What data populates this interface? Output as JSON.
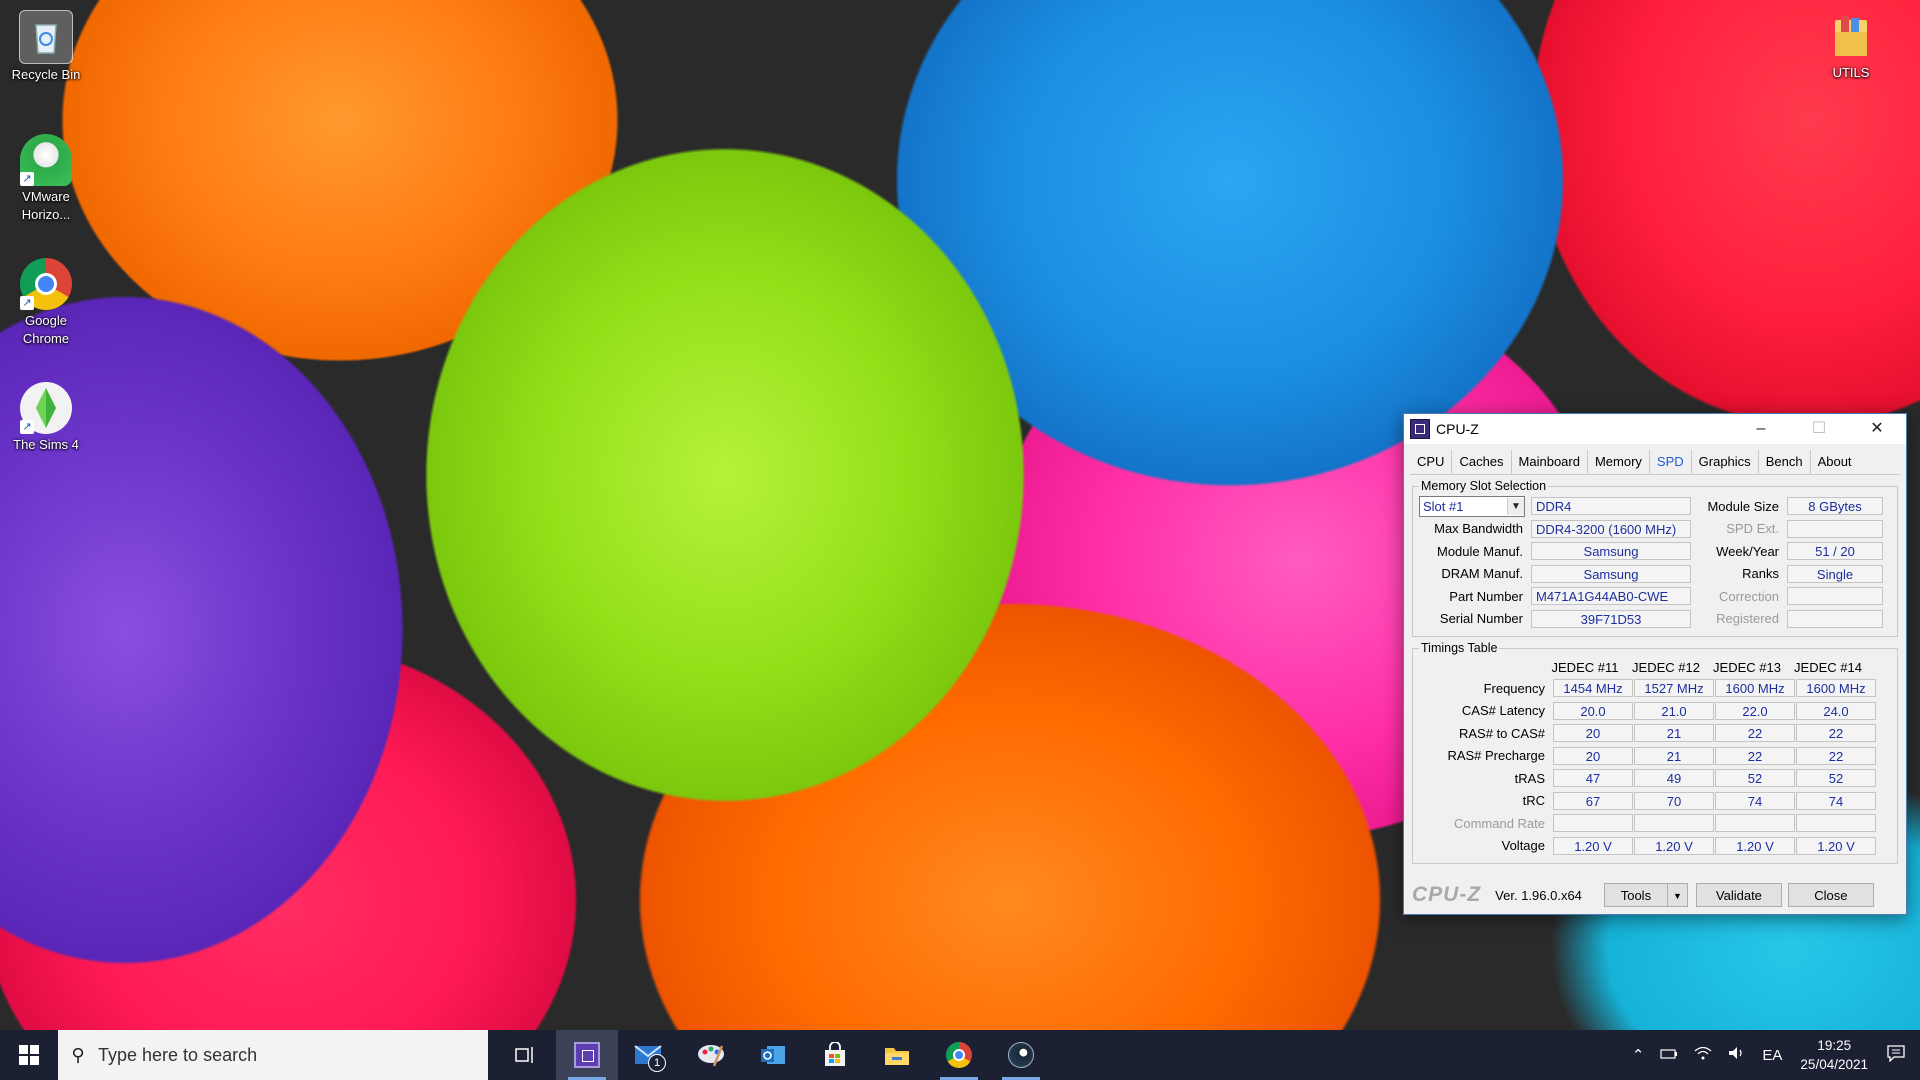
{
  "desktop": {
    "icons": [
      {
        "label": "Recycle Bin"
      },
      {
        "label": "VMware Horizo..."
      },
      {
        "label": "Google Chrome"
      },
      {
        "label": "The Sims 4"
      },
      {
        "label": "UTILS"
      }
    ]
  },
  "cpuz": {
    "title": "CPU-Z",
    "tabs": [
      "CPU",
      "Caches",
      "Mainboard",
      "Memory",
      "SPD",
      "Graphics",
      "Bench",
      "About"
    ],
    "active_tab": "SPD",
    "slot_section": {
      "legend": "Memory Slot Selection",
      "slot": "Slot #1",
      "type": "DDR4",
      "module_size_label": "Module Size",
      "module_size": "8 GBytes",
      "max_bandwidth_label": "Max Bandwidth",
      "max_bandwidth": "DDR4-3200 (1600 MHz)",
      "spd_ext_label": "SPD Ext.",
      "spd_ext": "",
      "module_manuf_label": "Module Manuf.",
      "module_manuf": "Samsung",
      "week_year_label": "Week/Year",
      "week_year": "51 / 20",
      "dram_manuf_label": "DRAM Manuf.",
      "dram_manuf": "Samsung",
      "ranks_label": "Ranks",
      "ranks": "Single",
      "part_number_label": "Part Number",
      "part_number": "M471A1G44AB0-CWE",
      "correction_label": "Correction",
      "correction": "",
      "serial_number_label": "Serial Number",
      "serial_number": "39F71D53",
      "registered_label": "Registered",
      "registered": ""
    },
    "timings": {
      "legend": "Timings Table",
      "columns": [
        "JEDEC #11",
        "JEDEC #12",
        "JEDEC #13",
        "JEDEC #14"
      ],
      "rows": [
        {
          "label": "Frequency",
          "values": [
            "1454 MHz",
            "1527 MHz",
            "1600 MHz",
            "1600 MHz"
          ]
        },
        {
          "label": "CAS# Latency",
          "values": [
            "20.0",
            "21.0",
            "22.0",
            "24.0"
          ]
        },
        {
          "label": "RAS# to CAS#",
          "values": [
            "20",
            "21",
            "22",
            "22"
          ]
        },
        {
          "label": "RAS# Precharge",
          "values": [
            "20",
            "21",
            "22",
            "22"
          ]
        },
        {
          "label": "tRAS",
          "values": [
            "47",
            "49",
            "52",
            "52"
          ]
        },
        {
          "label": "tRC",
          "values": [
            "67",
            "70",
            "74",
            "74"
          ]
        },
        {
          "label": "Command Rate",
          "values": [
            "",
            "",
            "",
            ""
          ]
        },
        {
          "label": "Voltage",
          "values": [
            "1.20 V",
            "1.20 V",
            "1.20 V",
            "1.20 V"
          ]
        }
      ]
    },
    "footer": {
      "logo": "CPU-Z",
      "version": "Ver. 1.96.0.x64",
      "tools_label": "Tools",
      "validate_label": "Validate",
      "close_label": "Close"
    }
  },
  "taskbar": {
    "search_placeholder": "Type here to search",
    "mail_badge": "1",
    "tray_language": "EA",
    "clock_time": "19:25",
    "clock_date": "25/04/2021"
  }
}
